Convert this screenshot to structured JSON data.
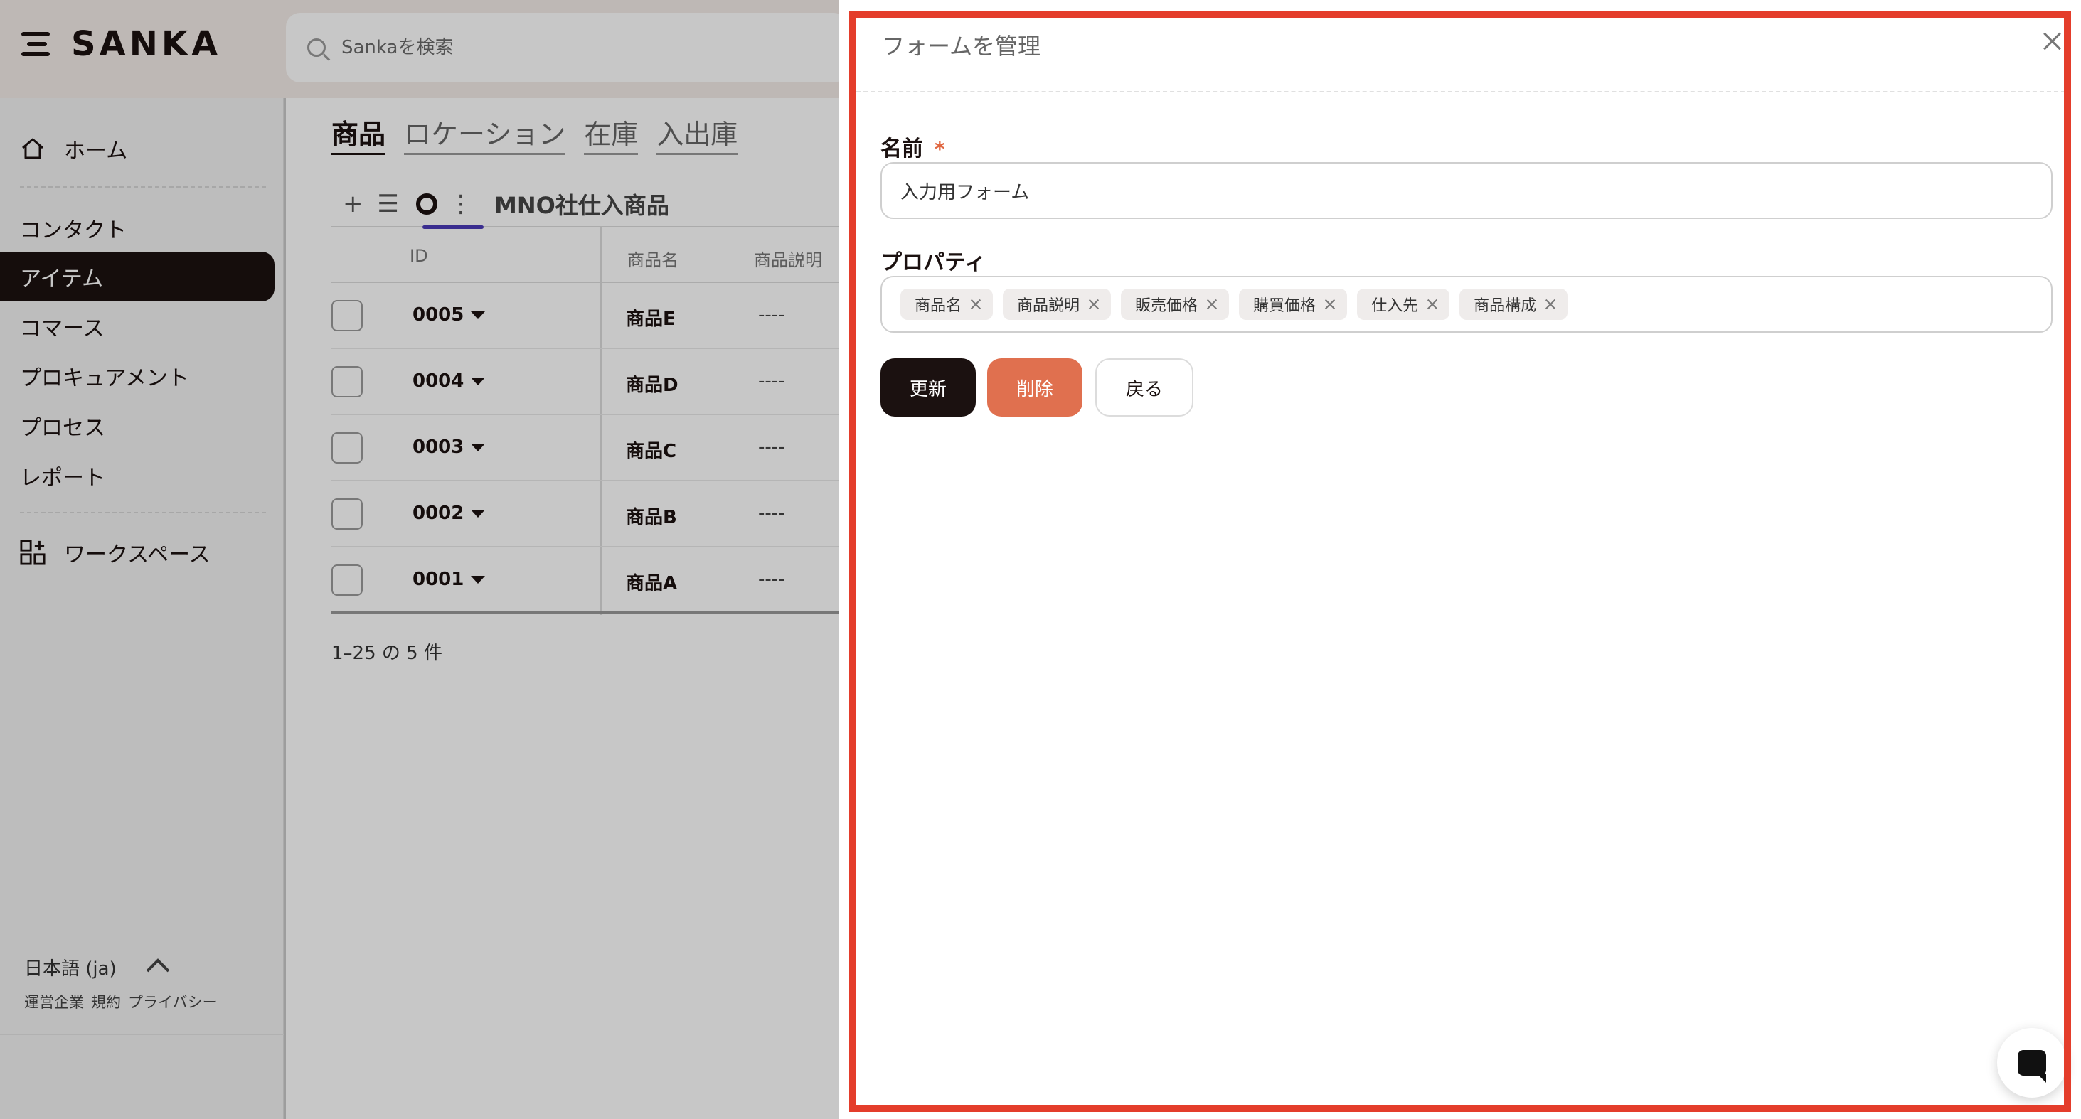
{
  "brand": {
    "name": "SANKA"
  },
  "search": {
    "placeholder": "Sankaを検索"
  },
  "sidebar": {
    "items": [
      {
        "label": "ホーム"
      },
      {
        "label": "コンタクト"
      },
      {
        "label": "アイテム"
      },
      {
        "label": "コマース"
      },
      {
        "label": "プロキュアメント"
      },
      {
        "label": "プロセス"
      },
      {
        "label": "レポート"
      },
      {
        "label": "ワークスペース"
      }
    ],
    "language": "日本語 (ja)",
    "footer_links": [
      "運営企業",
      "規約",
      "プライバシー"
    ]
  },
  "content": {
    "tabs": [
      "商品",
      "ロケーション",
      "在庫",
      "入出庫"
    ],
    "view_bar": {
      "add": "+",
      "list": "☰",
      "more": "⋮",
      "view_name": "MNO社仕入商品"
    },
    "table": {
      "headers": [
        "ID",
        "商品名",
        "商品説明"
      ],
      "rows": [
        {
          "id": "0005",
          "name": "商品E",
          "desc": "----"
        },
        {
          "id": "0004",
          "name": "商品D",
          "desc": "----"
        },
        {
          "id": "0003",
          "name": "商品C",
          "desc": "----"
        },
        {
          "id": "0002",
          "name": "商品B",
          "desc": "----"
        },
        {
          "id": "0001",
          "name": "商品A",
          "desc": "----"
        }
      ]
    },
    "pagination": "1–25 の 5 件"
  },
  "drawer": {
    "title": "フォームを管理",
    "name_label": "名前",
    "required_mark": "*",
    "name_value": "入力用フォーム",
    "properties_label": "プロパティ",
    "properties": [
      "商品名",
      "商品説明",
      "販売価格",
      "購買価格",
      "仕入先",
      "商品構成"
    ],
    "buttons": {
      "update": "更新",
      "delete": "削除",
      "back": "戻る"
    }
  },
  "colors": {
    "dark": "#1b1110",
    "delete": "#e0704f",
    "highlight": "#e43d2b",
    "required": "#e0653f",
    "view_underline": "#4b3ab8"
  }
}
